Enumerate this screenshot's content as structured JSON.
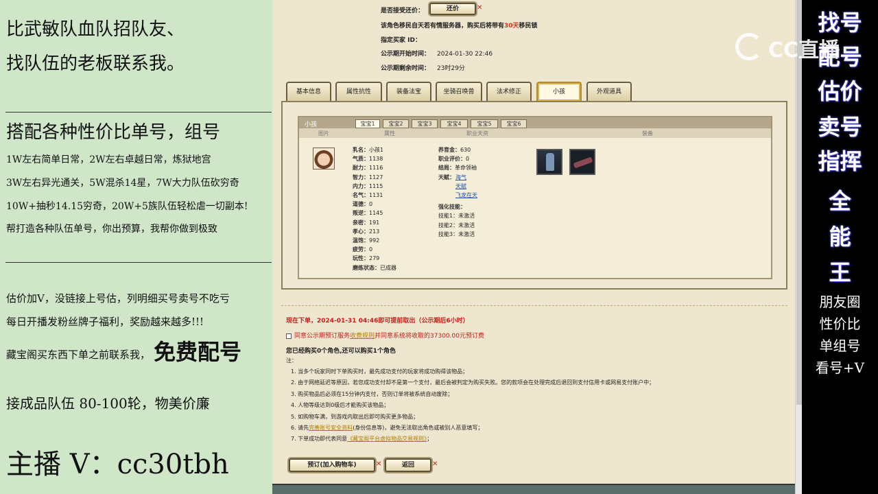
{
  "left_panel": {
    "line1": "比武敏队血队招队友、",
    "line2": "找队伍的老板联系我。",
    "line3": "搭配各种性价比单号，组号",
    "line4": "1W左右简单日常，2W左右卓越日常，炼狱地宫",
    "line5": "3W左右异光通关，5W混杀14星，7W大力队伍砍穷奇",
    "line6": "10W+抽秒14.15穷奇，20W+5族队伍轻松虐一切副本!",
    "line7": "帮打造各种队伍单号，你出预算，我帮你做到极致",
    "line8": "估价加V，没链接上号估，列明细买号卖号不吃亏",
    "line9": "每日开播发粉丝牌子福利，奖励越来越多!!!",
    "line10a": "藏宝阁买东西下单之前联系我，",
    "line10b": "免费配号",
    "line11": "接成品队伍 80-100轮，物美价廉",
    "line12": "主播 V：cc30tbh"
  },
  "header": {
    "bargain_label": "是否接受还价：",
    "bargain_button": "还价",
    "migrate_note_pre": "该角色移民自天若有情服务器，购买后将带有",
    "migrate_days": "30天",
    "migrate_note_post": "移民锁",
    "buyer_label": "指定买家 ID：",
    "start_label": "公示期开始时间：",
    "start_value": "2024-01-30 22:46",
    "remain_label": "公示期剩余时间：",
    "remain_value": "23时29分"
  },
  "tabs": [
    "基本信息",
    "属性抗性",
    "装备法宝",
    "坐骑召唤兽",
    "法术修正",
    "小孩",
    "外观道具"
  ],
  "child_panel": {
    "title": "小孩",
    "subtabs": [
      "宝宝1",
      "宝宝2",
      "宝宝3",
      "宝宝4",
      "宝宝5",
      "宝宝6"
    ],
    "col_image": "图片",
    "col_attr": "属性",
    "col_career": "职业天资",
    "col_equip": "装备",
    "stats_left": [
      {
        "k": "乳名：",
        "v": "小孩1"
      },
      {
        "k": "气质：",
        "v": "1138"
      },
      {
        "k": "耐力：",
        "v": "1116"
      },
      {
        "k": "智力：",
        "v": "1127"
      },
      {
        "k": "内力：",
        "v": "1115"
      },
      {
        "k": "名气：",
        "v": "1131"
      },
      {
        "k": "道德：",
        "v": "0"
      },
      {
        "k": "叛逆：",
        "v": "1145"
      },
      {
        "k": "亲密：",
        "v": "191"
      },
      {
        "k": "孝心：",
        "v": "213"
      },
      {
        "k": "温饱：",
        "v": "992"
      },
      {
        "k": "疲劳：",
        "v": "0"
      },
      {
        "k": "玩性：",
        "v": "279"
      },
      {
        "k": "磨练状态：",
        "v": "已成器"
      }
    ],
    "stats_right": [
      {
        "k": "养育金：",
        "v": "630"
      },
      {
        "k": "职业评价：",
        "v": "0"
      },
      {
        "k": "结局：",
        "v": "革命领袖"
      }
    ],
    "talent_label": "天赋：",
    "talents": [
      "海气",
      "天赋",
      "飞龙在天"
    ],
    "skill_label": "强化技能：",
    "skills": [
      "技能1：未激活",
      "技能2：未激活",
      "技能3：未激活"
    ]
  },
  "order": {
    "deadline": "现在下单，2024-01-31 04:46即可提前取出（公示期后6小时）",
    "agree_pre": "同意公示期预订服务",
    "agree_link": "收费规则",
    "agree_post": "并同意系统将收取的37300.00元预订费",
    "bought": "您已经购买0个角色,还可以购买1个角色",
    "note_label": "注：",
    "notes": [
      "1. 当多个玩家同时下单购买时，最先成功支付的玩家将成功购得该物品；",
      "2. 由于网络延迟等原因，若您成功支付却不是第一个支付，最后会被判定为购买失败。您的款项会在处理完成后退回到支付信用卡或网易支付账户中；",
      "3. 购买物品后必须在15分钟内支付，否则订单将被系统自动废除；",
      "4. 人物等级达到0级后才能购买该物品；",
      "5. 如购物车满，到游戏内取出后即可购买更多物品；",
      "7. 下单成功即代表同意"
    ],
    "note6_pre": "6. 请先",
    "note6_link": "完善账号安全资料",
    "note6_post": "(身份信息等)，避免无法取出角色或被别人恶意填写；",
    "note7_link": "《藏宝阁平台虚拟物品交易规则》",
    "note7_post": "；",
    "btn_reserve": "预订(加入购物车)",
    "btn_back": "返回"
  },
  "right_panel": {
    "big": [
      "找号",
      "配号",
      "估价",
      "卖号",
      "指挥",
      "全",
      "能",
      "王"
    ],
    "small": [
      "朋友圈",
      "性价比",
      "单组号",
      "看号+V"
    ]
  },
  "logo": {
    "text": "CC直播"
  }
}
